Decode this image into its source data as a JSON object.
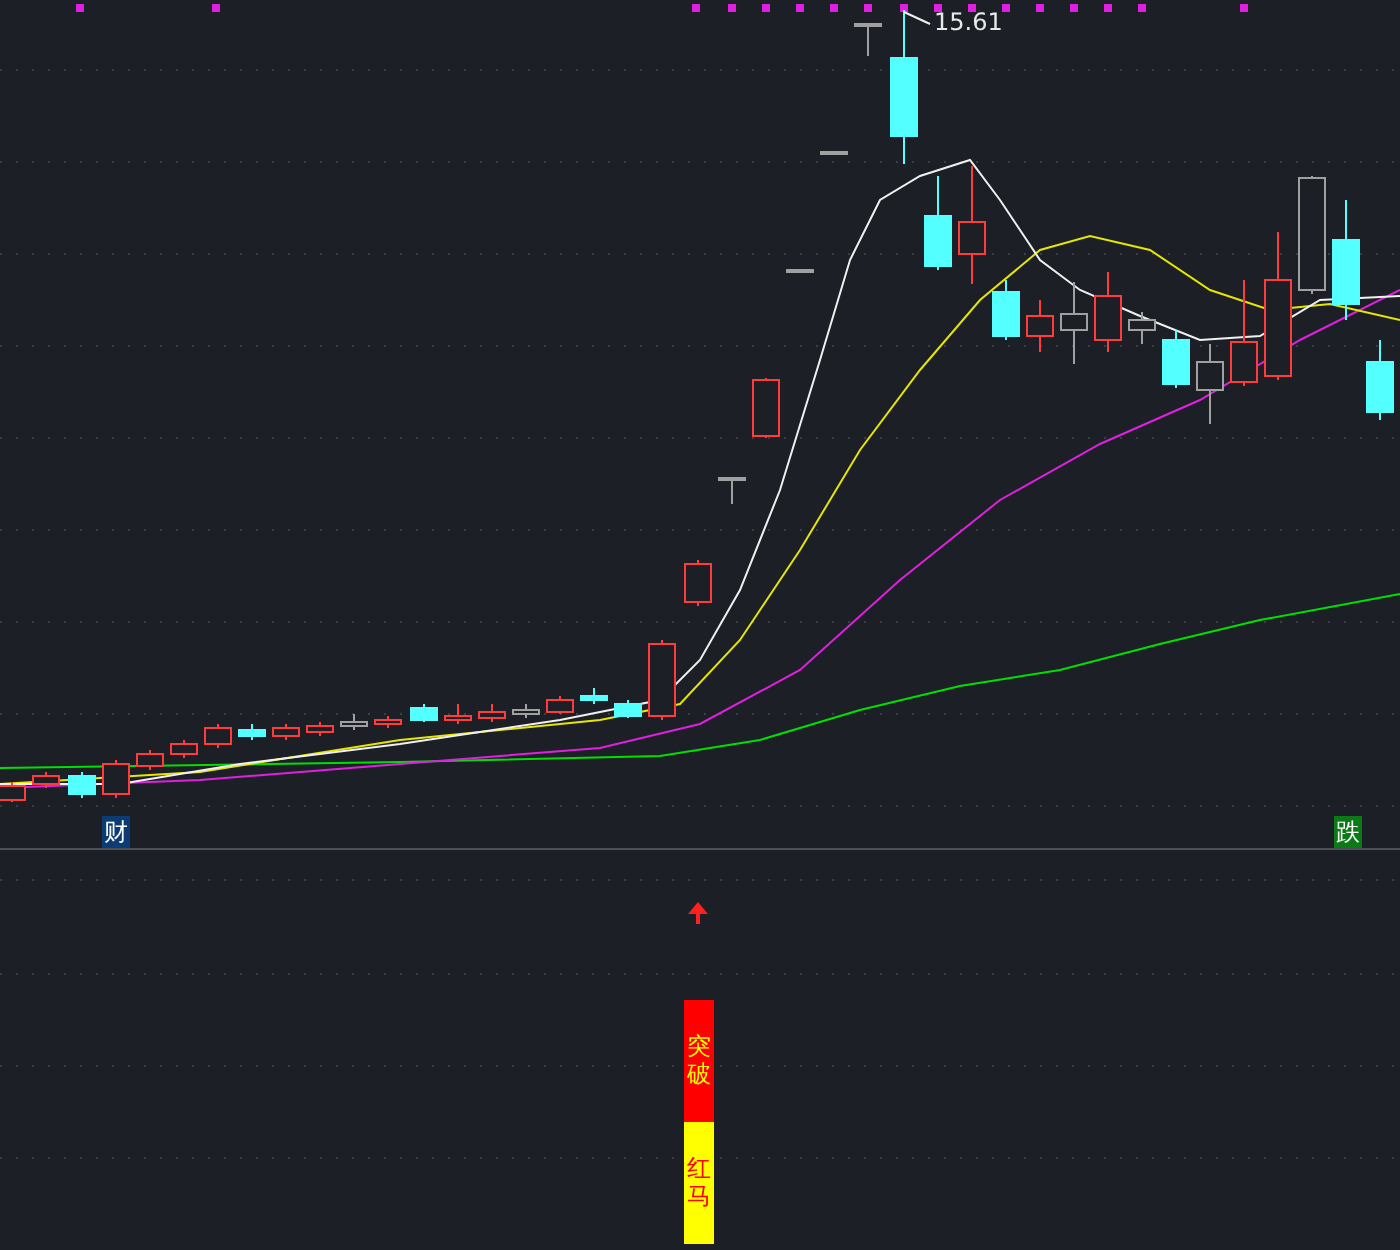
{
  "price_label": {
    "text": "15.61"
  },
  "markers": [
    {
      "text": "财",
      "color": "#0b3c73"
    },
    {
      "text": "跌",
      "color": "#0b7a16"
    }
  ],
  "signal": {
    "segments": [
      {
        "text": "突破",
        "color": "#ff0000"
      },
      {
        "text": "红马",
        "color": "#ffff00"
      }
    ]
  }
}
